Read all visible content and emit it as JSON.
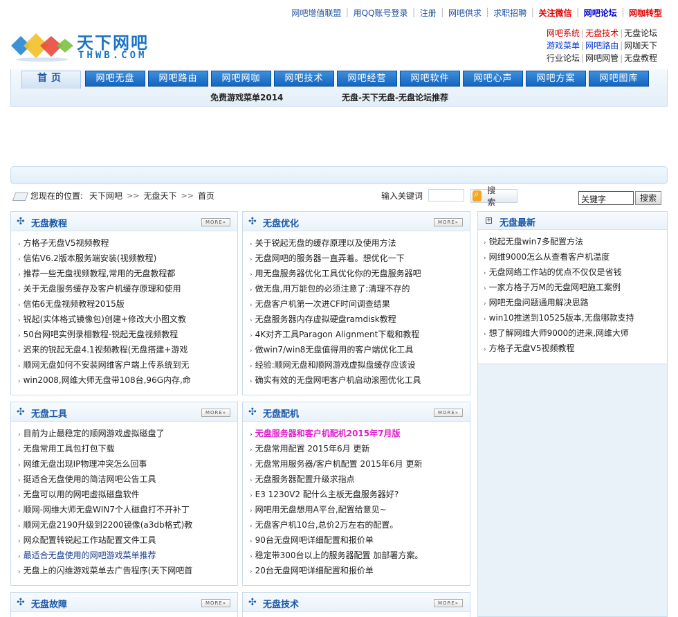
{
  "top_links": [
    {
      "label": "网吧增值联盟",
      "style": "normal"
    },
    {
      "label": "用QQ账号登录",
      "style": "normal"
    },
    {
      "label": "注册",
      "style": "normal"
    },
    {
      "label": "网吧供求",
      "style": "normal"
    },
    {
      "label": "求职招聘",
      "style": "normal"
    },
    {
      "label": "关注微信",
      "style": "red"
    },
    {
      "label": "网吧论坛",
      "style": "blue"
    },
    {
      "label": "网咖转型",
      "style": "red"
    }
  ],
  "logo": {
    "cn": "天下网吧",
    "en": "THWB.COM"
  },
  "quick_links": [
    [
      {
        "label": "网吧系统",
        "style": "red"
      },
      {
        "label": "无盘技术",
        "style": "red"
      },
      {
        "label": "无盘论坛",
        "style": "normal"
      }
    ],
    [
      {
        "label": "游戏菜单",
        "style": "blue"
      },
      {
        "label": "网吧路由",
        "style": "blue"
      },
      {
        "label": "网咖天下",
        "style": "normal"
      }
    ],
    [
      {
        "label": "行业论坛",
        "style": "normal"
      },
      {
        "label": "网吧网管",
        "style": "normal"
      },
      {
        "label": "无盘教程",
        "style": "normal"
      }
    ]
  ],
  "nav": {
    "home": "首页",
    "tabs": [
      "网吧无盘",
      "网吧路由",
      "网吧网咖",
      "网吧技术",
      "网吧经营",
      "网吧软件",
      "网吧心声",
      "网吧方案",
      "网吧图库"
    ]
  },
  "subnav": {
    "left": "免费游戏菜单2014",
    "right": "无盘-天下无盘-无盘论坛推荐"
  },
  "location": {
    "prefix": "您现在的位置:",
    "crumbs": [
      "天下网吧",
      "无盘天下",
      "首页"
    ],
    "sep": ">>"
  },
  "search": {
    "label": "输入关键词",
    "button": "搜 索",
    "value2": "关键字",
    "button2": "搜索"
  },
  "more_label": "MORE»",
  "boxes": {
    "tutorial": {
      "title": "无盘教程",
      "items": [
        "方格子无盘V5视频教程",
        "信佑V6.2版本服务端安装(视频教程)",
        "推荐一些无盘视频教程,常用的无盘教程都",
        "关于无盘服务缓存及客户机缓存原理和使用",
        "信佑6无盘视频教程2015版",
        "锐起(实体格式镜像包)创建+修改大小图文教",
        "50台网吧实例录相教程-锐起无盘视频教程",
        "迟来的锐起无盘4.1视频教程(无盘搭建+游戏",
        "顺网无盘如何不安装网维客户端上传系统到无",
        "win2008,网维大师无盘带108台,96G内存,命"
      ]
    },
    "optimize": {
      "title": "无盘优化",
      "items": [
        "关于锐起无盘的缓存原理以及使用方法",
        "无盘网吧的服务器一直弄着。想优化一下",
        "用无盘服务器优化工具优化你的无盘服务器吧",
        "做无盘,用万能包的必须注意了:清理不存的",
        "无盘客户机第一次进CF时间调查结果",
        "无盘服务器内存虚拟硬盘ramdisk教程",
        "4K对齐工具Paragon Alignment下载和教程",
        "做win7/win8无盘值得用的客户端优化工具",
        "经验:顺网无盘和顺网游戏虚拟盘缓存应该设",
        "确实有效的无盘网吧客户机启动滚图优化工具"
      ]
    },
    "tools": {
      "title": "无盘工具",
      "items": [
        "目前为止最稳定的顺网游戏虚拟磁盘了",
        "无盘常用工具包打包下载",
        "网维无盘出现IP物理冲突怎么回事",
        "挺适合无盘使用的简洁网吧公告工具",
        "无盘可以用的网吧虚拟磁盘软件",
        "顺网-网维大师无盘WIN7个人磁盘打不开补丁",
        "顺网无盘2190升级到2200镜像(a3db格式)教",
        "网众配置转锐起工作站配置文件工具",
        "最适合无盘使用的网吧游戏菜单推荐",
        "无盘上的闪维游戏菜单去广告程序(天下网吧首"
      ]
    },
    "config": {
      "title": "无盘配机",
      "items": [
        "无盘服务器和客户机配机2015年7月版",
        "无盘常用配置 2015年6月 更新",
        "无盘常用服务器/客户机配置 2015年6月 更新",
        "无盘服务器配置升级求指点",
        "E3 1230V2 配什么主板无盘服务器好?",
        "网吧用无盘想用A平台,配置给意见~",
        "无盘客户机10台,总价2万左右的配置。",
        "90台无盘网吧详细配置和报价单",
        "稳定带300台以上的服务器配置 加部署方案。",
        "20台无盘网吧详细配置和报价单"
      ]
    },
    "fault": {
      "title": "无盘故障"
    },
    "tech": {
      "title": "无盘技术"
    }
  },
  "latest": {
    "title": "无盘最新",
    "items": [
      "锐起无盘win7多配置方法",
      "网维9000怎么从查看客户机温度",
      "无盘网络工作站的优点不仅仅是省钱",
      "一家方格子万M的无盘网吧施工案例",
      "网吧无盘问题通用解决思路",
      "win10推送到10525版本,无盘哪款支持",
      "想了解网维大师9000的进来,网维大师",
      "方格子无盘V5视频教程"
    ]
  }
}
